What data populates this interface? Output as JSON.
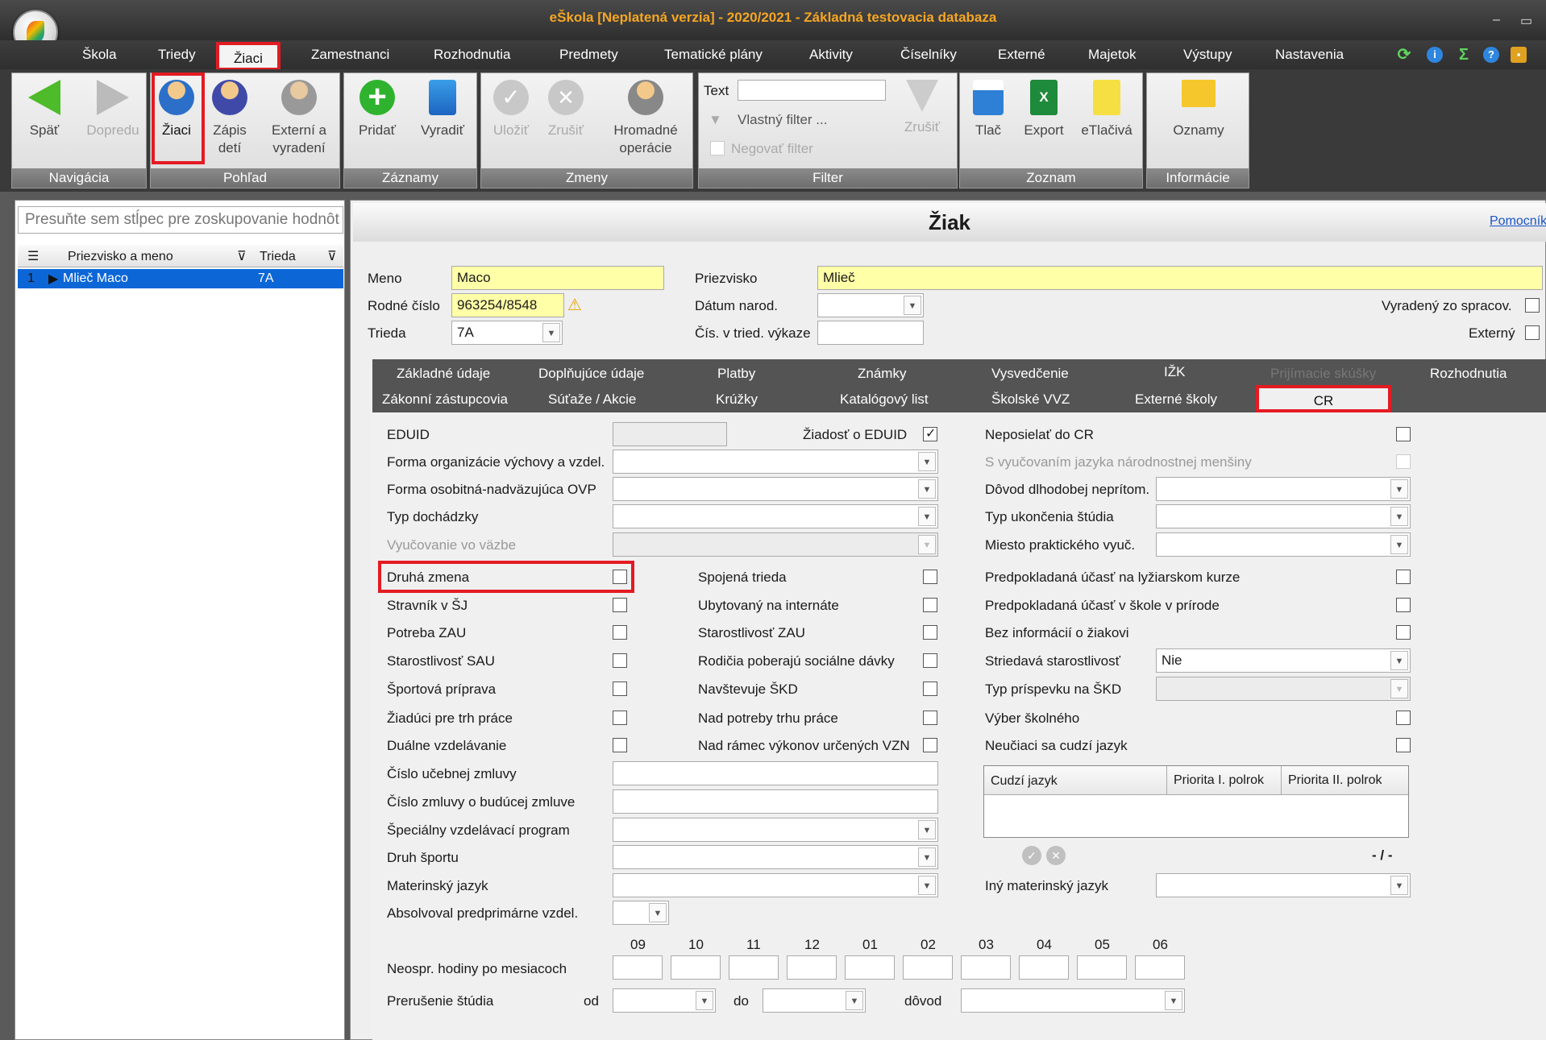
{
  "window": {
    "title": "eŠkola [Neplatená verzia] - 2020/2021 - Základná testovacia databaza",
    "min": "‒",
    "max": "▭"
  },
  "menu": [
    "Škola",
    "Triedy",
    "Žiaci",
    "Zamestnanci",
    "Rozhodnutia",
    "Predmety",
    "Tematické plány",
    "Aktivity",
    "Číselníky",
    "Externé",
    "Majetok",
    "Výstupy",
    "Nastavenia"
  ],
  "ribbon": {
    "nav": {
      "caption": "Navigácia",
      "back": "Späť",
      "forward": "Dopredu"
    },
    "view": {
      "caption": "Pohľad",
      "students": "Žiaci",
      "enroll1": "Zápis",
      "enroll2": "detí",
      "ext1": "Externí a",
      "ext2": "vyradení"
    },
    "records": {
      "caption": "Záznamy",
      "add": "Pridať",
      "remove": "Vyradiť"
    },
    "changes": {
      "caption": "Zmeny",
      "save": "Uložiť",
      "cancel": "Zrušiť",
      "bulk1": "Hromadné",
      "bulk2": "operácie"
    },
    "filter": {
      "caption": "Filter",
      "text_label": "Text",
      "custom": "Vlastný filter ...",
      "negate": "Negovať filter",
      "cancel": "Zrušiť"
    },
    "list": {
      "caption": "Zoznam",
      "print": "Tlač",
      "export": "Export",
      "eprint": "eTlačivá"
    },
    "info": {
      "caption": "Informácie",
      "notices": "Oznamy"
    }
  },
  "grid": {
    "group_hint": "Presuňte sem stĺpec pre zoskupovanie hodnôt",
    "col_name": "Priezvisko a meno",
    "col_class": "Trieda",
    "rows": [
      {
        "num": "1",
        "name": "Mlieč Maco",
        "class": "7A"
      }
    ]
  },
  "student": {
    "title": "Žiak",
    "helper_link": "Pomocník",
    "first_name_label": "Meno",
    "first_name": "Maco",
    "surname_label": "Priezvisko",
    "surname": "Mlieč",
    "birth_no_label": "Rodné číslo",
    "birth_no": "963254/8548",
    "dob_label": "Dátum narod.",
    "dob": "",
    "class_label": "Trieda",
    "class": "7A",
    "class_no_label": "Čís. v tried. výkaze",
    "class_no": "",
    "removed_label": "Vyradený zo spracov.",
    "external_label": "Externý"
  },
  "tabs": {
    "row1": [
      "Základné údaje",
      "Doplňujúce údaje",
      "Platby",
      "Známky",
      "Vysvedčenie",
      "IŽK",
      "Prijímacie skúšky",
      "Rozhodnutia"
    ],
    "row2": [
      "Zákonní zástupcovia",
      "Súťaže / Akcie",
      "Krúžky",
      "Katalógový list",
      "Školské VVZ",
      "Externé školy",
      "CR"
    ]
  },
  "cr": {
    "eduid_label": "EDUID",
    "eduid": "",
    "eduid_request": "Žiadosť o EDUID",
    "no_send": "Neposielať do CR",
    "minority_lang": "S vyučovaním jazyka národnostnej menšiny",
    "form_org": "Forma organizácie výchovy a vzdel.",
    "form_ovp": "Forma osobitná-nadväzujúca OVP",
    "attendance": "Typ dochádzky",
    "custody": "Vyučovanie vo väzbe",
    "absence_reason": "Dôvod dlhodobej neprítom.",
    "end_type": "Typ ukončenia štúdia",
    "practice_place": "Miesto praktického vyuč.",
    "c1": [
      "Druhá zmena",
      "Stravník v ŠJ",
      "Potreba ZAU",
      "Starostlivosť SAU",
      "Športová príprava",
      "Žiadúci pre trh práce",
      "Duálne vzdelávanie"
    ],
    "c2": [
      "Spojená trieda",
      "Ubytovaný na internáte",
      "Starostlivosť ZAU",
      "Rodičia poberajú sociálne dávky",
      "Navštevuje ŠKD",
      "Nad potreby trhu práce",
      "Nad rámec výkonov určených VZN"
    ],
    "c3": [
      "Predpokladaná účasť na lyžiarskom kurze",
      "Predpokladaná účasť v škole v prírode",
      "Bez informácií o žiakovi"
    ],
    "alternating_label": "Striedavá starostlivosť",
    "alternating": "Nie",
    "skd_fee": "Typ príspevku na ŠKD",
    "tuition": "Výber školného",
    "no_foreign": "Neučiaci sa cudzí jazyk",
    "lang_cols": [
      "Cudzí jazyk",
      "Priorita I. polrok",
      "Priorita II. polrok"
    ],
    "lang_pager": "- / -",
    "contract_no": "Číslo učebnej zmluvy",
    "future_contract": "Číslo zmluvy o budúcej zmluve",
    "special_program": "Špeciálny vzdelávací program",
    "sport_type": "Druh športu",
    "mother_tongue": "Materinský jazyk",
    "other_tongue": "Iný materinský jazyk",
    "preprimary": "Absolvoval predprimárne vzdel.",
    "months": [
      "09",
      "10",
      "11",
      "12",
      "01",
      "02",
      "03",
      "04",
      "05",
      "06"
    ],
    "unexcused": "Neospr. hodiny po mesiacoch",
    "interruption": "Prerušenie štúdia",
    "from": "od",
    "to": "do",
    "reason": "dôvod"
  }
}
